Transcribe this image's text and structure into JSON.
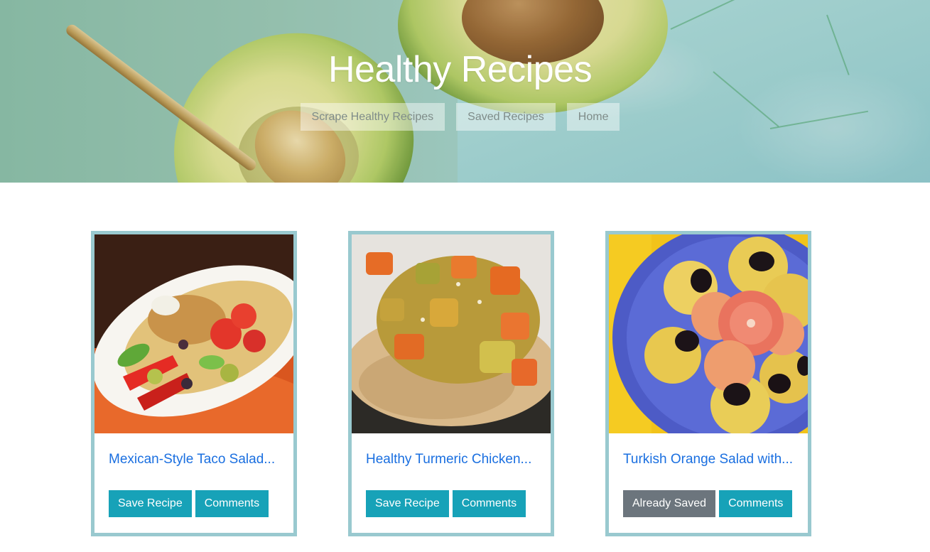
{
  "header": {
    "title": "Healthy Recipes",
    "nav": [
      "Scrape Healthy Recipes",
      "Saved Recipes",
      "Home"
    ]
  },
  "recipes": [
    {
      "title": "Mexican-Style Taco Salad...",
      "primary_action": "Save Recipe",
      "primary_state": "save",
      "secondary_action": "Comments"
    },
    {
      "title": "Healthy Turmeric Chicken...",
      "primary_action": "Save Recipe",
      "primary_state": "save",
      "secondary_action": "Comments"
    },
    {
      "title": "Turkish Orange Salad with...",
      "primary_action": "Already Saved",
      "primary_state": "saved",
      "secondary_action": "Comments"
    }
  ],
  "colors": {
    "accent": "#17a2b8",
    "link": "#1a6fe0",
    "saved": "#6c757d",
    "card_border": "#99c9cf"
  }
}
